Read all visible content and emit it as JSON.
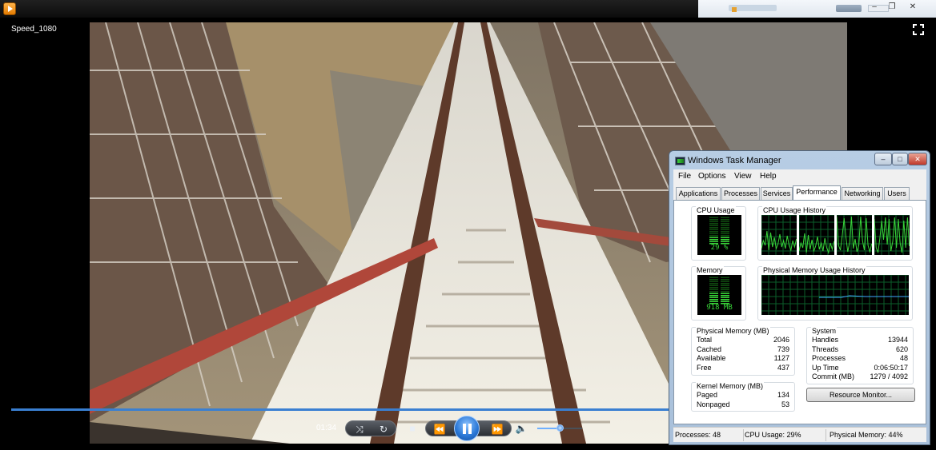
{
  "player": {
    "title": "Speed_1080",
    "time": "01:34",
    "seek_progress": 0.72,
    "volume": 0.5,
    "controls": {
      "shuffle_icon": "shuffle-icon",
      "repeat_icon": "repeat-icon",
      "stop_icon": "stop-icon",
      "previous_icon": "rewind-icon",
      "play_pause_icon": "pause-icon",
      "next_icon": "fast-forward-icon",
      "mute_icon": "speaker-icon",
      "fullscreen_icon": "fullscreen-icon"
    },
    "colors": {
      "seek": "#3a7fd1",
      "accent": "#2d7ad8"
    }
  },
  "taskmgr": {
    "title": "Windows Task Manager",
    "menu": [
      "File",
      "Options",
      "View",
      "Help"
    ],
    "tabs": [
      "Applications",
      "Processes",
      "Services",
      "Performance",
      "Networking",
      "Users"
    ],
    "active_tab": "Performance",
    "cpu_usage": {
      "label": "CPU Usage",
      "value": "29 %",
      "level": 0.29
    },
    "cpu_history": {
      "label": "CPU Usage History",
      "cores": 4
    },
    "memory": {
      "label": "Memory",
      "value": "918 MB",
      "level": 0.45
    },
    "mem_history": {
      "label": "Physical Memory Usage History"
    },
    "physical_memory": {
      "label": "Physical Memory (MB)",
      "rows": [
        {
          "name": "Total",
          "value": "2046"
        },
        {
          "name": "Cached",
          "value": "739"
        },
        {
          "name": "Available",
          "value": "1127"
        },
        {
          "name": "Free",
          "value": "437"
        }
      ]
    },
    "system": {
      "label": "System",
      "rows": [
        {
          "name": "Handles",
          "value": "13944"
        },
        {
          "name": "Threads",
          "value": "620"
        },
        {
          "name": "Processes",
          "value": "48"
        },
        {
          "name": "Up Time",
          "value": "0:06:50:17"
        },
        {
          "name": "Commit (MB)",
          "value": "1279 / 4092"
        }
      ]
    },
    "kernel_memory": {
      "label": "Kernel Memory (MB)",
      "rows": [
        {
          "name": "Paged",
          "value": "134"
        },
        {
          "name": "Nonpaged",
          "value": "53"
        }
      ]
    },
    "resource_monitor_button": "Resource Monitor...",
    "status": {
      "processes": "Processes: 48",
      "cpu": "CPU Usage: 29%",
      "memory": "Physical Memory: 44%"
    },
    "colors": {
      "graph_line": "#39d439",
      "grid": "#0b5e2a"
    }
  }
}
